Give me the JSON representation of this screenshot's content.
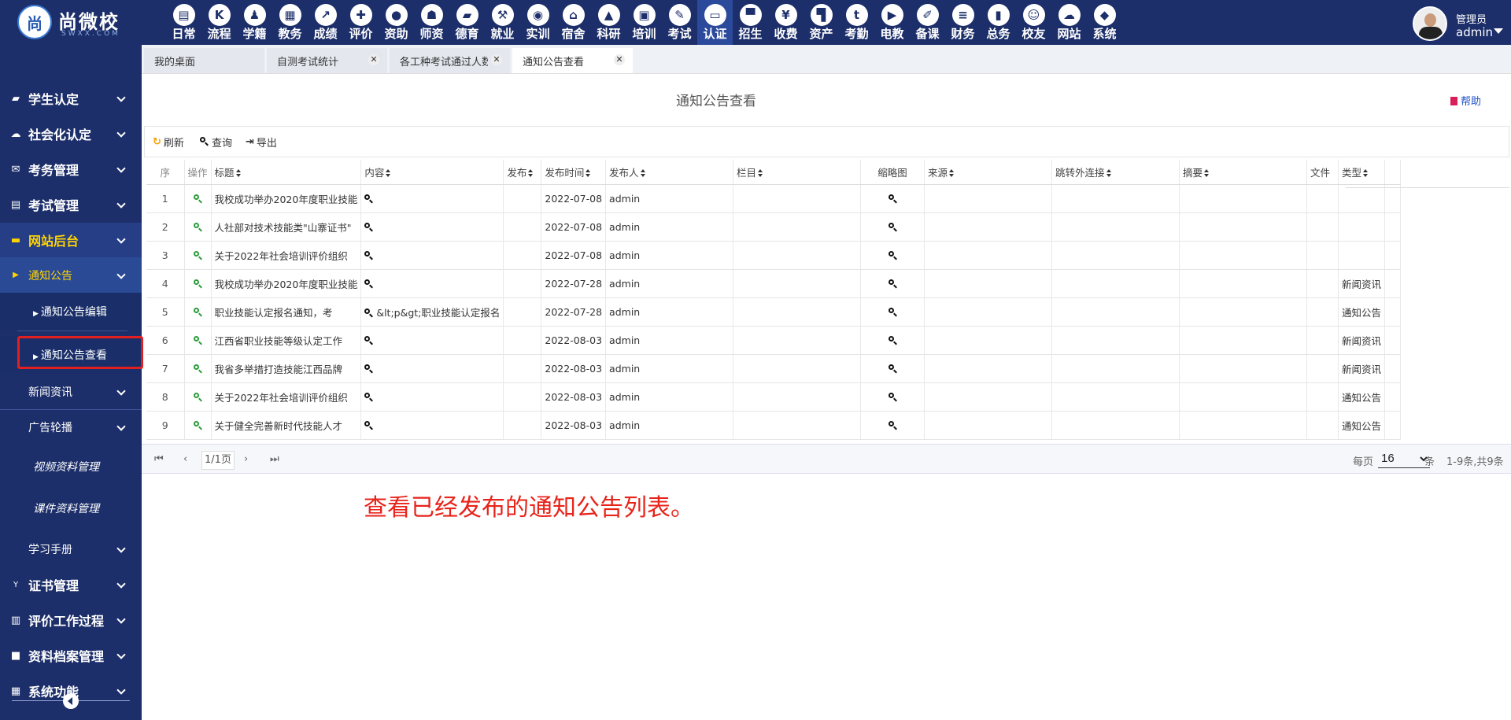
{
  "brand": {
    "logo_char": "尚",
    "name": "尚微校",
    "sub": "SWXX.COM"
  },
  "modules": [
    {
      "label": "日常",
      "icon": "document-icon",
      "glyph": "▤"
    },
    {
      "label": "流程",
      "icon": "flow-icon",
      "glyph": "K"
    },
    {
      "label": "学籍",
      "icon": "student-icon",
      "glyph": "♟"
    },
    {
      "label": "教务",
      "icon": "calendar-icon",
      "glyph": "▦"
    },
    {
      "label": "成绩",
      "icon": "chart-icon",
      "glyph": "↗"
    },
    {
      "label": "评价",
      "icon": "evaluate-icon",
      "glyph": "✚"
    },
    {
      "label": "资助",
      "icon": "aid-icon",
      "glyph": "●"
    },
    {
      "label": "师资",
      "icon": "teacher-icon",
      "glyph": "☗"
    },
    {
      "label": "德育",
      "icon": "book-icon",
      "glyph": "▰"
    },
    {
      "label": "就业",
      "icon": "hammer-icon",
      "glyph": "⚒"
    },
    {
      "label": "实训",
      "icon": "training-icon",
      "glyph": "◉"
    },
    {
      "label": "宿舍",
      "icon": "home-icon",
      "glyph": "⌂"
    },
    {
      "label": "科研",
      "icon": "mortarboard-icon",
      "glyph": "▲"
    },
    {
      "label": "培训",
      "icon": "image-icon",
      "glyph": "▣"
    },
    {
      "label": "考试",
      "icon": "wrench-icon",
      "glyph": "✎"
    },
    {
      "label": "认证",
      "icon": "monitor-icon",
      "glyph": "▭"
    },
    {
      "label": "招生",
      "icon": "bus-icon",
      "glyph": "▀"
    },
    {
      "label": "收费",
      "icon": "yen-icon",
      "glyph": "¥"
    },
    {
      "label": "资产",
      "icon": "train-icon",
      "glyph": "▜"
    },
    {
      "label": "考勤",
      "icon": "tumblr-icon",
      "glyph": "t"
    },
    {
      "label": "电教",
      "icon": "media-icon",
      "glyph": "▶"
    },
    {
      "label": "备课",
      "icon": "edit-icon",
      "glyph": "✐"
    },
    {
      "label": "财务",
      "icon": "newspaper-icon",
      "glyph": "≡"
    },
    {
      "label": "总务",
      "icon": "bar-chart-icon",
      "glyph": "▮"
    },
    {
      "label": "校友",
      "icon": "group-icon",
      "glyph": "☺"
    },
    {
      "label": "网站",
      "icon": "cloud-icon",
      "glyph": "☁"
    },
    {
      "label": "系统",
      "icon": "cube-icon",
      "glyph": "◆"
    }
  ],
  "active_module": "认证",
  "user": {
    "role": "管理员",
    "name": "admin"
  },
  "sidebar": {
    "items": [
      {
        "label": "学生认定",
        "icon": "book-icon",
        "glyph": "▰"
      },
      {
        "label": "社会化认定",
        "icon": "cloud-icon",
        "glyph": "☁"
      },
      {
        "label": "考务管理",
        "icon": "envelope-icon",
        "glyph": "✉"
      },
      {
        "label": "考试管理",
        "icon": "file-icon",
        "glyph": "▤"
      },
      {
        "label": "网站后台",
        "icon": "folder-icon",
        "glyph": "▬"
      },
      {
        "label": "通知公告"
      },
      {
        "label": "通知公告编辑"
      },
      {
        "label": "通知公告查看"
      },
      {
        "label": "新闻资讯"
      },
      {
        "label": "广告轮播"
      },
      {
        "label": "视频资料管理"
      },
      {
        "label": "课件资料管理"
      },
      {
        "label": "学习手册"
      },
      {
        "label": "证书管理",
        "icon": "certificate-icon",
        "glyph": "Y"
      },
      {
        "label": "评价工作过程",
        "icon": "columns-icon",
        "glyph": "▥"
      },
      {
        "label": "资料档案管理",
        "icon": "square-icon",
        "glyph": "■"
      },
      {
        "label": "系统功能",
        "icon": "grid-icon",
        "glyph": "▦"
      }
    ]
  },
  "tabs": [
    {
      "label": "我的桌面",
      "closable": false
    },
    {
      "label": "自测考试统计",
      "closable": true
    },
    {
      "label": "各工种考试通过人数",
      "closable": true
    },
    {
      "label": "通知公告查看",
      "closable": true
    }
  ],
  "page": {
    "title": "通知公告查看",
    "help": "帮助"
  },
  "toolbar": {
    "refresh": "刷新",
    "query": "查询",
    "export": "导出"
  },
  "table": {
    "columns": [
      "序",
      "操作",
      "标题",
      "内容",
      "发布",
      "发布时间",
      "发布人",
      "栏目",
      "缩略图",
      "来源",
      "跳转外连接",
      "摘要",
      "文件",
      "类型"
    ],
    "rows": [
      {
        "no": "1",
        "title": "我校成功举办2020年度职业技能",
        "content": "",
        "pub": "",
        "time": "2022-07-08",
        "author": "admin",
        "column": "",
        "source": "",
        "link": "",
        "summary": "",
        "file": "",
        "type": ""
      },
      {
        "no": "2",
        "title": "人社部对技术技能类\"山寨证书\"",
        "content": "",
        "pub": "",
        "time": "2022-07-08",
        "author": "admin",
        "column": "",
        "source": "",
        "link": "",
        "summary": "",
        "file": "",
        "type": ""
      },
      {
        "no": "3",
        "title": "关于2022年社会培训评价组织",
        "content": "",
        "pub": "",
        "time": "2022-07-08",
        "author": "admin",
        "column": "",
        "source": "",
        "link": "",
        "summary": "",
        "file": "",
        "type": ""
      },
      {
        "no": "4",
        "title": "我校成功举办2020年度职业技能",
        "content": "",
        "pub": "",
        "time": "2022-07-28",
        "author": "admin",
        "column": "",
        "source": "",
        "link": "",
        "summary": "",
        "file": "",
        "type": "新闻资讯"
      },
      {
        "no": "5",
        "title": "职业技能认定报名通知，考",
        "content": "&lt;p&gt;职业技能认定报名",
        "pub": "",
        "time": "2022-07-28",
        "author": "admin",
        "column": "",
        "source": "",
        "link": "",
        "summary": "",
        "file": "",
        "type": "通知公告"
      },
      {
        "no": "6",
        "title": "江西省职业技能等级认定工作",
        "content": "",
        "pub": "",
        "time": "2022-08-03",
        "author": "admin",
        "column": "",
        "source": "",
        "link": "",
        "summary": "",
        "file": "",
        "type": "新闻资讯"
      },
      {
        "no": "7",
        "title": "我省多举措打造技能江西品牌",
        "content": "",
        "pub": "",
        "time": "2022-08-03",
        "author": "admin",
        "column": "",
        "source": "",
        "link": "",
        "summary": "",
        "file": "",
        "type": "新闻资讯"
      },
      {
        "no": "8",
        "title": "关于2022年社会培训评价组织",
        "content": "",
        "pub": "",
        "time": "2022-08-03",
        "author": "admin",
        "column": "",
        "source": "",
        "link": "",
        "summary": "",
        "file": "",
        "type": "通知公告"
      },
      {
        "no": "9",
        "title": "关于健全完善新时代技能人才",
        "content": "",
        "pub": "",
        "time": "2022-08-03",
        "author": "admin",
        "column": "",
        "source": "",
        "link": "",
        "summary": "",
        "file": "",
        "type": "通知公告"
      }
    ]
  },
  "pager": {
    "page": "1/1页",
    "per_label": "每页",
    "per_value": "16",
    "per_options": [
      "16"
    ],
    "unit": "条",
    "total": "1-9条,共9条"
  },
  "annotation": "查看已经发布的通知公告列表。",
  "colors": {
    "nav_bg": "#1d2f6a",
    "active_menu": "#ffd400",
    "highlight": "#e02020",
    "annotation": "#e8231a"
  }
}
